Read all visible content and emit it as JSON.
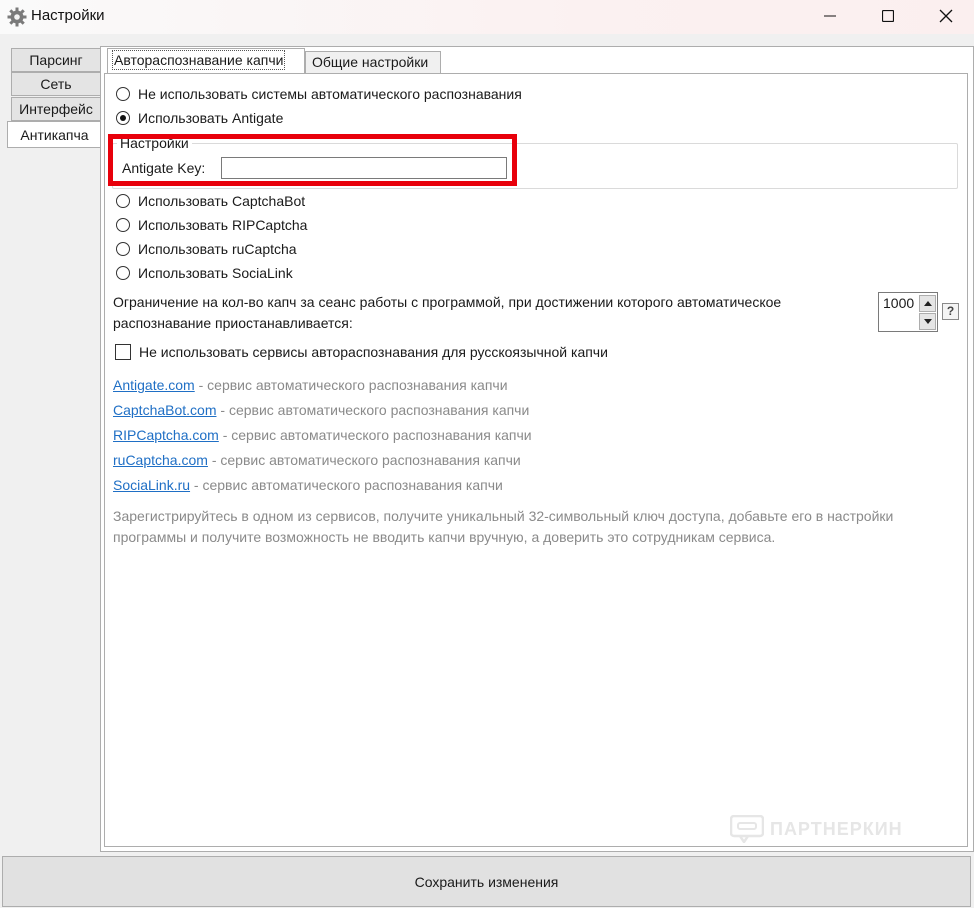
{
  "window": {
    "title": "Настройки",
    "icon": "gear-icon"
  },
  "side_tabs": [
    {
      "label": "Парсинг"
    },
    {
      "label": "Сеть"
    },
    {
      "label": "Интерфейс"
    },
    {
      "label": "Антикапча"
    }
  ],
  "top_tabs": [
    {
      "label": "Автораспознавание капчи"
    },
    {
      "label": "Общие настройки"
    }
  ],
  "radios": {
    "none": "Не использовать системы автоматического распознавания",
    "antigate": "Использовать Antigate",
    "captchabot": "Использовать CaptchaBot",
    "ripcaptcha": "Использовать RIPCaptcha",
    "rucaptcha": "Использовать ruCaptcha",
    "socialink": "Использовать SociaLink",
    "selected": "antigate"
  },
  "settings_group": {
    "title": "Настройки",
    "key_label": "Antigate Key:",
    "key_value": ""
  },
  "limit": {
    "text": "Ограничение на кол-во капч за сеанс работы с программой, при достижении которого автоматическое распознавание приостанавливается:",
    "value": "1000",
    "help": "?"
  },
  "checkbox": {
    "label": "Не использовать сервисы автораспознавания для русскоязычной капчи",
    "checked": false
  },
  "links": [
    {
      "name": "Antigate.com",
      "desc": " - сервис автоматического распознавания капчи"
    },
    {
      "name": "CaptchaBot.com",
      "desc": " - сервис автоматического распознавания капчи"
    },
    {
      "name": "RIPCaptcha.com",
      "desc": " - сервис автоматического распознавания капчи"
    },
    {
      "name": "ruCaptcha.com",
      "desc": " - сервис автоматического распознавания капчи"
    },
    {
      "name": "SociaLink.ru",
      "desc": " - сервис автоматического распознавания капчи"
    }
  ],
  "info": "Зарегистрируйтесь в одном из сервисов, получите уникальный 32-символьный ключ доступа, добавьте его в настройки программы и получите возможность не вводить капчи вручную, а доверить это сотрудникам сервиса.",
  "watermark": "ПАРТНЕРКИН",
  "save_button": "Сохранить изменения",
  "colors": {
    "highlight": "#e8000b",
    "link": "#1f6fc5",
    "muted_text": "#8a8a8a"
  }
}
